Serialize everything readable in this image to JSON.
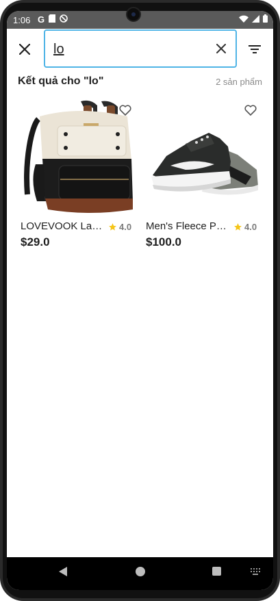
{
  "status_bar": {
    "time": "1:06",
    "left_icons": [
      "google-icon",
      "sd-card-icon",
      "do-not-disturb-icon"
    ],
    "right_icons": [
      "wifi-icon",
      "cellular-icon",
      "battery-icon"
    ]
  },
  "search": {
    "value": "lo",
    "close_icon": "close-icon",
    "clear_icon": "clear-icon",
    "filter_icon": "filter-icon",
    "accent_color": "#4fb4e6"
  },
  "results": {
    "title": "Kết quả cho \"lo\"",
    "count": "2 sản phẩm"
  },
  "products": [
    {
      "name": "LOVEVOOK Laptop Backpack",
      "rating": "4.0",
      "price": "$29.0",
      "image": "backpack-image"
    },
    {
      "name": "Men's Fleece Pullover Sneakers",
      "rating": "4.0",
      "price": "$100.0",
      "image": "sneaker-image"
    }
  ],
  "colors": {
    "star": "#f5c518",
    "navbar": "#000000"
  }
}
